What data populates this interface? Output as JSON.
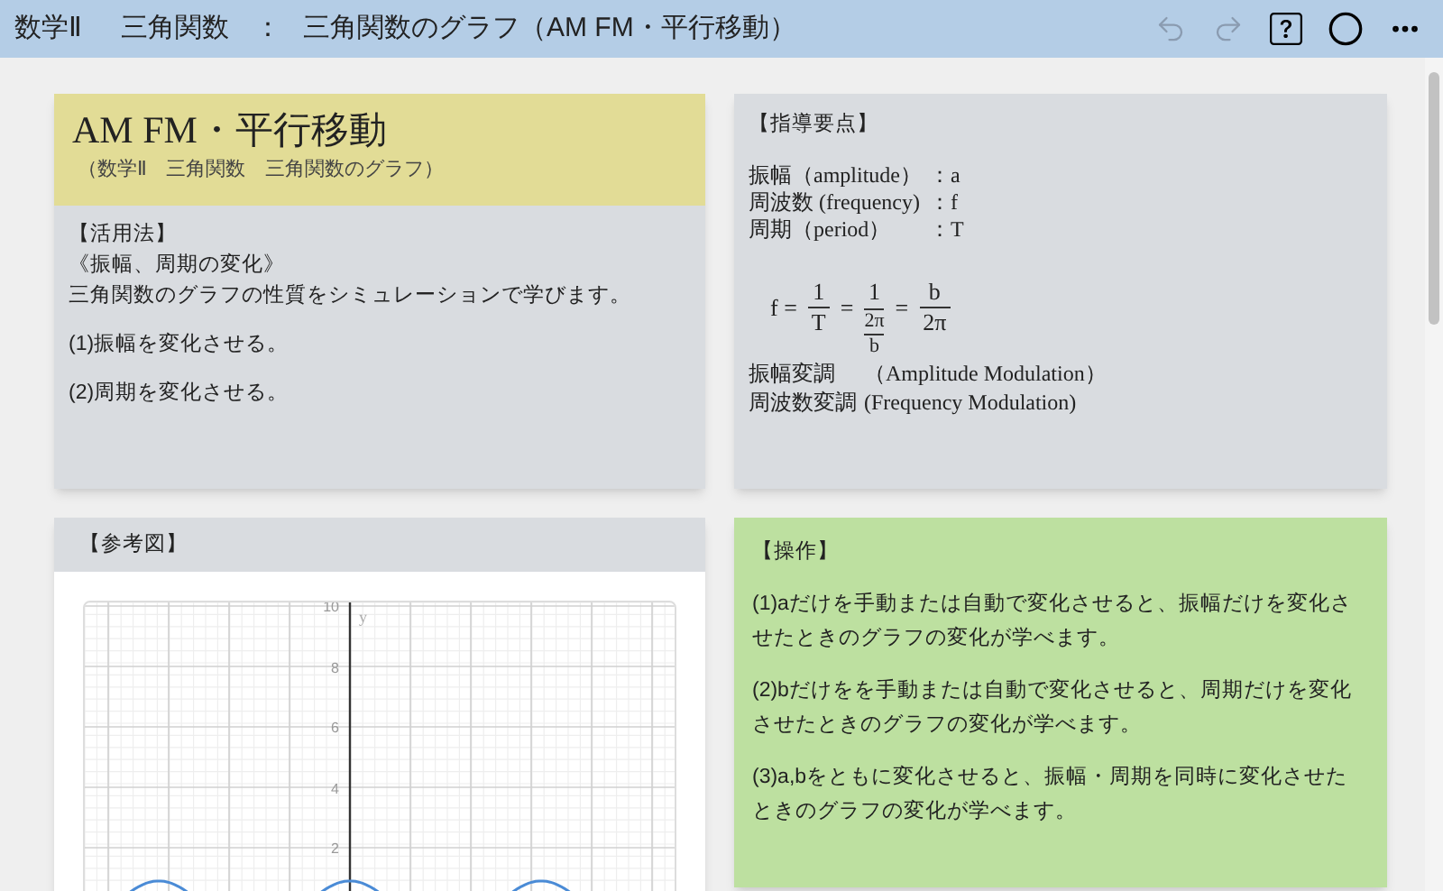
{
  "header": {
    "subject": "数学Ⅱ",
    "unit": "三角関数",
    "separator": "：",
    "topic": "三角関数のグラフ（AM FM・平行移動）",
    "tools": [
      {
        "kind": "undo",
        "disabled": true
      },
      {
        "kind": "redo",
        "disabled": true
      },
      {
        "kind": "help",
        "disabled": false
      },
      {
        "kind": "circle",
        "disabled": false
      },
      {
        "kind": "more",
        "disabled": false
      }
    ]
  },
  "intro_card": {
    "title": "AM FM・平行移動",
    "subtitle": "（数学Ⅱ　三角関数　三角関数のグラフ）",
    "heading": "【活用法】",
    "subheading": "《振幅、周期の変化》",
    "description": "三角関数のグラフの性質をシミュレーションで学びます。",
    "steps": [
      "(1)振幅を変化させる。",
      "(2)周期を変化させる。"
    ]
  },
  "points_card": {
    "heading": "【指導要点】",
    "definitions": [
      {
        "term": "振幅（amplitude）",
        "symbol": "：a"
      },
      {
        "term": "周波数 (frequency)",
        "symbol": "：f"
      },
      {
        "term": "周期（period）",
        "symbol": "：T"
      }
    ],
    "formula": [
      {
        "kind": "text",
        "text": "f ="
      },
      {
        "kind": "frac",
        "num": "1",
        "den": "T"
      },
      {
        "kind": "text",
        "text": "="
      },
      {
        "kind": "nested",
        "num": "1",
        "den_num": "2π",
        "den_den": "b"
      },
      {
        "kind": "text",
        "text": "="
      },
      {
        "kind": "frac",
        "num": "b",
        "den": "2π"
      }
    ],
    "modulations": [
      {
        "term": "振幅変調",
        "english": "（Amplitude Modulation）"
      },
      {
        "term": "周波数変調",
        "english": "(Frequency Modulation)"
      }
    ]
  },
  "figure_card": {
    "heading": "【参考図】",
    "y_axis_label": "y",
    "y_ticks": [
      "10",
      "8",
      "6",
      "4",
      "2"
    ]
  },
  "operation_card": {
    "heading": "【操作】",
    "steps": [
      "(1)aだけを手動または自動で変化させると、振幅だけを変化させたときのグラフの変化が学べます。",
      "(2)bだけをを手動または自動で変化させると、周期だけを変化させたときのグラフの変化が学べます。",
      "(3)a,bをともに変化させると、振幅・周期を同時に変化させたときのグラフの変化が学べます。"
    ]
  }
}
